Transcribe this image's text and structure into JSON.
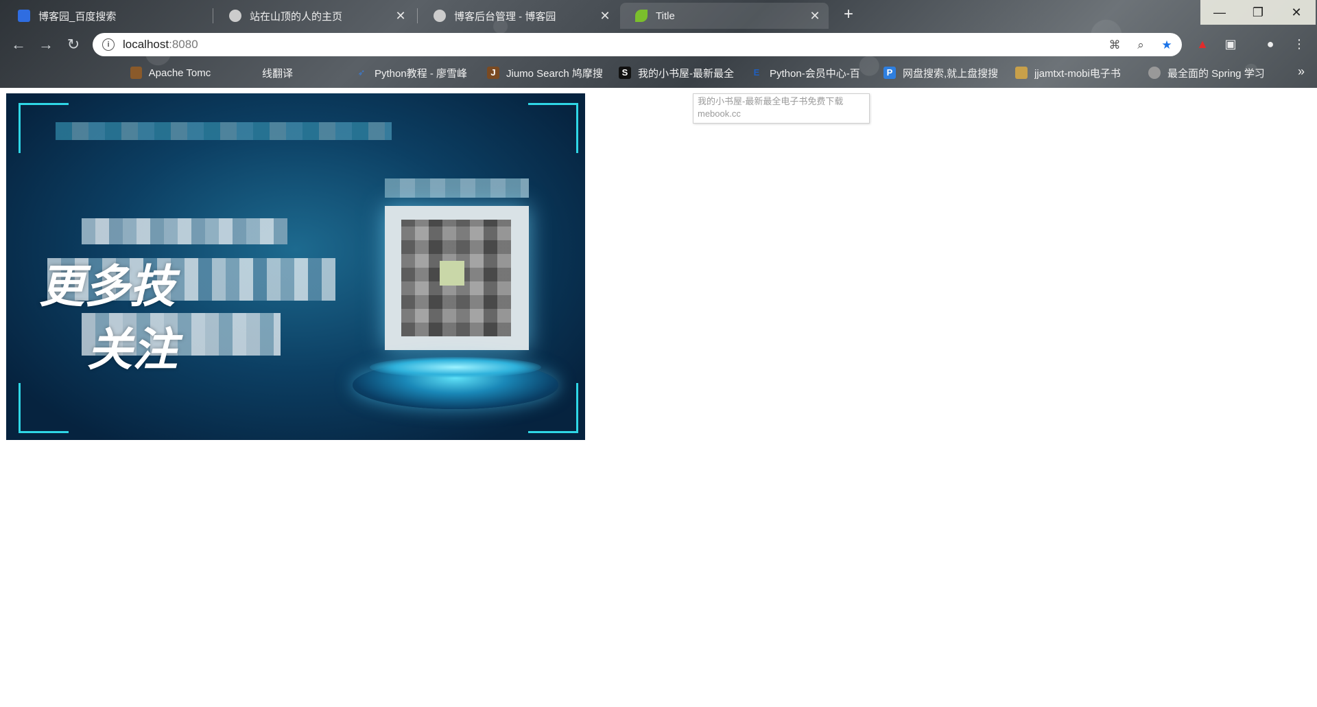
{
  "tabs": [
    {
      "title": "博客园_百度搜索",
      "icon": "baidu-paw-icon",
      "color": "#2f6de1",
      "active": false
    },
    {
      "title": "站在山顶的人的主页",
      "icon": "cnblogs-icon",
      "color": "#cccccc",
      "active": false
    },
    {
      "title": "博客后台管理 - 博客园",
      "icon": "cnblogs-icon",
      "color": "#cccccc",
      "active": false
    },
    {
      "title": "Title",
      "icon": "spring-leaf-icon",
      "color": "#7bbf2c",
      "active": true
    }
  ],
  "window_controls": {
    "minimize": "—",
    "restore": "❐",
    "close": "✕"
  },
  "new_tab_label": "+",
  "omnibox": {
    "host": "localhost",
    "port": ":8080"
  },
  "bookmarks": [
    {
      "label": "Apache Tomca",
      "icon": "tomcat-icon",
      "color": "#8a5a2a"
    },
    {
      "label": "线翻译",
      "icon": "translate-icon",
      "color": "#8a8a8a"
    },
    {
      "label": "Python教程 - 廖雪峰",
      "icon": "rocket-icon",
      "color": "#3a7bd5"
    },
    {
      "label": "Jiumo Search 鸠摩搜",
      "icon": "jiumo-icon",
      "color": "#7a4a22"
    },
    {
      "label": "我的小书屋-最新最全",
      "icon": "s-square-icon",
      "color": "#111111"
    },
    {
      "label": "Python-会员中心-百",
      "icon": "e-book-icon",
      "color": "#1f5fbf"
    },
    {
      "label": "网盘搜索,就上盘搜搜",
      "icon": "p-square-icon",
      "color": "#2e7fe0"
    },
    {
      "label": "jjamtxt-mobi电子书",
      "icon": "jjam-icon",
      "color": "#c8a04a"
    },
    {
      "label": "最全面的 Spring 学习",
      "icon": "cnblogs-icon",
      "color": "#999999"
    }
  ],
  "more_bookmarks": "»",
  "tooltip": {
    "line1": "我的小书屋-最新最全电子书免费下载",
    "line2": "mebook.cc"
  },
  "banner": {
    "slogan_line1": "更多技",
    "slogan_line2": "关注"
  }
}
